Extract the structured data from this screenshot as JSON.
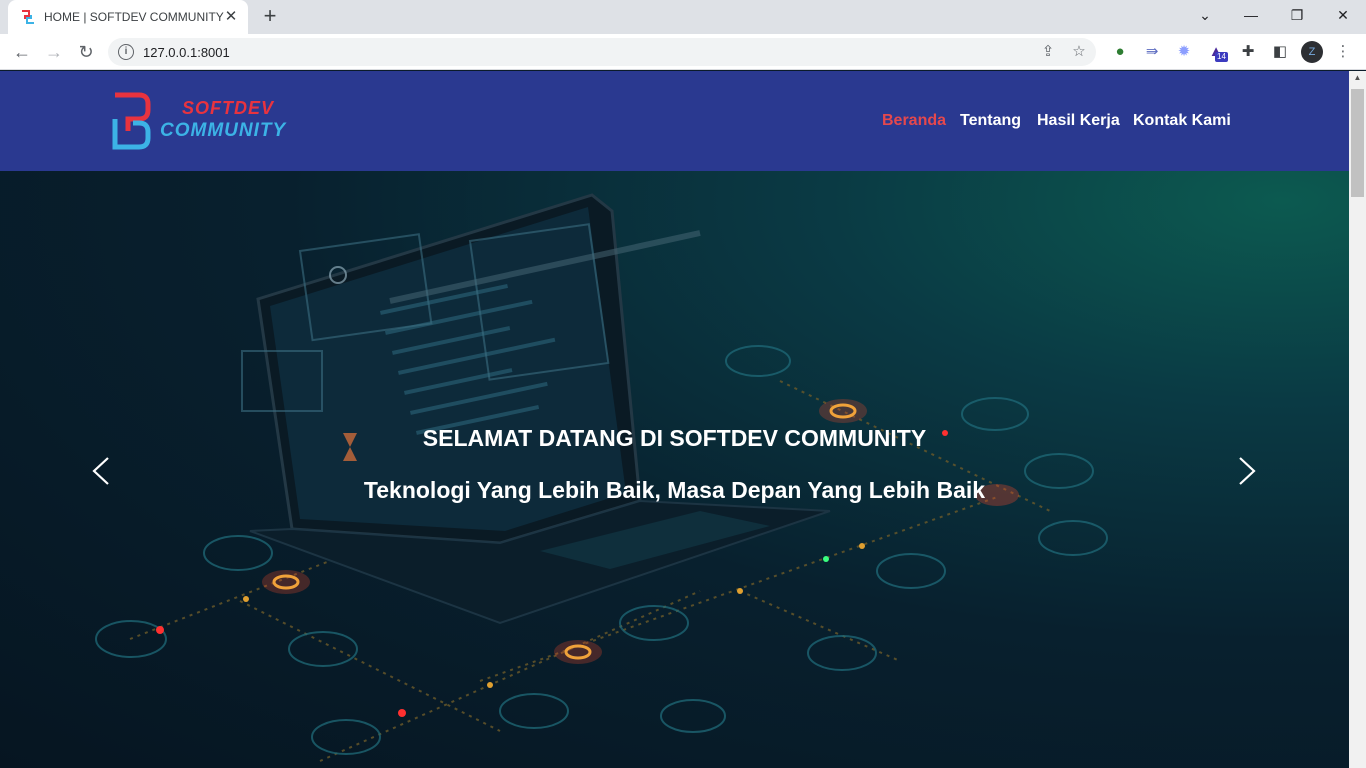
{
  "browser": {
    "tab_title": "HOME | SOFTDEV COMMUNITY",
    "url": "127.0.0.1:8001",
    "extension_badge": "14"
  },
  "site": {
    "logo_top": "SOFTDEV",
    "logo_bottom": "COMMUNITY",
    "nav": [
      "Beranda",
      "Tentang",
      "Hasil Kerja",
      "Kontak Kami"
    ],
    "active_nav": "Beranda",
    "hero_title": "SELAMAT DATANG DI SOFTDEV COMMUNITY",
    "hero_subtitle": "Teknologi Yang Lebih Baik, Masa Depan Yang Lebih Baik"
  },
  "colors": {
    "header_bg": "#2a3990",
    "nav_active": "#e5484d",
    "logo_red": "#e8333f",
    "logo_blue": "#3cb3e6"
  }
}
